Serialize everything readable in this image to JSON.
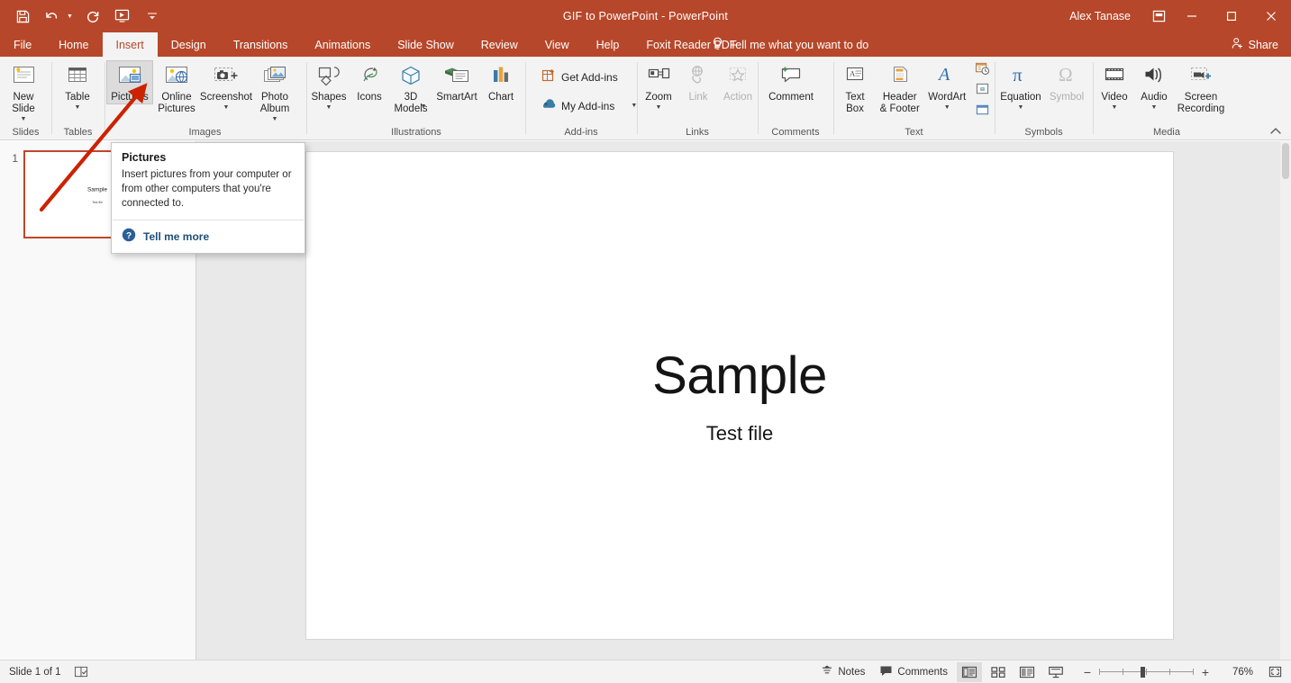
{
  "titlebar": {
    "document_title": "GIF to PowerPoint  -  PowerPoint",
    "account_name": "Alex Tanase",
    "quick_access": [
      {
        "name": "save",
        "label": "Save"
      },
      {
        "name": "undo",
        "label": "Undo"
      },
      {
        "name": "redo",
        "label": "Redo"
      },
      {
        "name": "start-from-beginning",
        "label": "Start From Beginning"
      },
      {
        "name": "customize-qat",
        "label": "Customize Quick Access Toolbar"
      }
    ],
    "window_controls": {
      "ribbon_display_options": "Ribbon Display Options",
      "minimize": "Minimize",
      "restore": "Restore Down",
      "close": "Close"
    }
  },
  "tabs": [
    {
      "label": "File",
      "active": false
    },
    {
      "label": "Home",
      "active": false
    },
    {
      "label": "Insert",
      "active": true
    },
    {
      "label": "Design",
      "active": false
    },
    {
      "label": "Transitions",
      "active": false
    },
    {
      "label": "Animations",
      "active": false
    },
    {
      "label": "Slide Show",
      "active": false
    },
    {
      "label": "Review",
      "active": false
    },
    {
      "label": "View",
      "active": false
    },
    {
      "label": "Help",
      "active": false
    },
    {
      "label": "Foxit Reader PDF",
      "active": false
    }
  ],
  "tell_me": "Tell me what you want to do",
  "share_label": "Share",
  "ribbon": {
    "groups": [
      {
        "name": "Slides",
        "label": "Slides",
        "items": [
          {
            "label": "New\nSlide",
            "icon": "new-slide-icon",
            "dropdown": true,
            "disabled": false
          }
        ]
      },
      {
        "name": "Tables",
        "label": "Tables",
        "items": [
          {
            "label": "Table",
            "icon": "table-icon",
            "dropdown": true,
            "disabled": false
          }
        ]
      },
      {
        "name": "Images",
        "label": "Images",
        "items": [
          {
            "label": "Pictures",
            "icon": "pictures-icon",
            "dropdown": false,
            "disabled": false,
            "pressed": true
          },
          {
            "label": "Online\nPictures",
            "icon": "online-pictures-icon",
            "dropdown": false,
            "disabled": false
          },
          {
            "label": "Screenshot",
            "icon": "screenshot-icon",
            "dropdown": true,
            "disabled": false
          },
          {
            "label": "Photo\nAlbum",
            "icon": "photo-album-icon",
            "dropdown": true,
            "disabled": false
          }
        ]
      },
      {
        "name": "Illustrations",
        "label": "Illustrations",
        "items": [
          {
            "label": "Shapes",
            "icon": "shapes-icon",
            "dropdown": true,
            "disabled": false
          },
          {
            "label": "Icons",
            "icon": "icons-icon",
            "dropdown": false,
            "disabled": false
          },
          {
            "label": "3D\nModels",
            "icon": "3d-models-icon",
            "dropdown": true,
            "disabled": false
          },
          {
            "label": "SmartArt",
            "icon": "smartart-icon",
            "dropdown": false,
            "disabled": false
          },
          {
            "label": "Chart",
            "icon": "chart-icon",
            "dropdown": false,
            "disabled": false
          }
        ]
      },
      {
        "name": "Add-ins",
        "label": "Add-ins",
        "items": [
          {
            "label": "Get Add-ins",
            "icon": "get-addins-icon",
            "dropdown": false,
            "disabled": false
          },
          {
            "label": "My Add-ins",
            "icon": "my-addins-icon",
            "dropdown": true,
            "disabled": false
          }
        ]
      },
      {
        "name": "Links",
        "label": "Links",
        "items": [
          {
            "label": "Zoom",
            "icon": "zoom-icon",
            "dropdown": true,
            "disabled": false
          },
          {
            "label": "Link",
            "icon": "link-icon",
            "dropdown": false,
            "disabled": true
          },
          {
            "label": "Action",
            "icon": "action-icon",
            "dropdown": false,
            "disabled": true
          }
        ]
      },
      {
        "name": "Comments",
        "label": "Comments",
        "items": [
          {
            "label": "Comment",
            "icon": "comment-icon",
            "dropdown": false,
            "disabled": false
          }
        ]
      },
      {
        "name": "Text",
        "label": "Text",
        "items": [
          {
            "label": "Text\nBox",
            "icon": "text-box-icon",
            "dropdown": false,
            "disabled": false
          },
          {
            "label": "Header\n& Footer",
            "icon": "header-footer-icon",
            "dropdown": false,
            "disabled": false
          },
          {
            "label": "WordArt",
            "icon": "wordart-icon",
            "dropdown": true,
            "disabled": false
          },
          {
            "label": "Date & Time",
            "icon": "date-time-icon",
            "mini": true
          },
          {
            "label": "Slide Number",
            "icon": "slide-number-icon",
            "mini": true
          },
          {
            "label": "Object",
            "icon": "object-icon",
            "mini": true
          }
        ]
      },
      {
        "name": "Symbols",
        "label": "Symbols",
        "items": [
          {
            "label": "Equation",
            "icon": "equation-icon",
            "dropdown": true,
            "disabled": false
          },
          {
            "label": "Symbol",
            "icon": "symbol-icon",
            "dropdown": false,
            "disabled": true
          }
        ]
      },
      {
        "name": "Media",
        "label": "Media",
        "items": [
          {
            "label": "Video",
            "icon": "video-icon",
            "dropdown": true,
            "disabled": false
          },
          {
            "label": "Audio",
            "icon": "audio-icon",
            "dropdown": true,
            "disabled": false
          },
          {
            "label": "Screen\nRecording",
            "icon": "screen-recording-icon",
            "dropdown": false,
            "disabled": false
          }
        ]
      }
    ],
    "collapse_label": "Collapse the Ribbon"
  },
  "tooltip": {
    "title": "Pictures",
    "body": "Insert pictures from your computer or from other computers that you're connected to.",
    "more_label": "Tell me more",
    "help_icon": "help-icon"
  },
  "slide_panel": {
    "slides": [
      {
        "number": "1",
        "title": "Sample",
        "subtitle": "Test file",
        "selected": true
      }
    ]
  },
  "slide": {
    "title": "Sample",
    "subtitle": "Test file"
  },
  "statusbar": {
    "slide_count": "Slide 1 of 1",
    "accessibility_label": "Accessibility Checker",
    "notes_label": "Notes",
    "comments_label": "Comments",
    "views": [
      {
        "name": "normal-view",
        "label": "Normal",
        "active": true
      },
      {
        "name": "slide-sorter-view",
        "label": "Slide Sorter",
        "active": false
      },
      {
        "name": "reading-view",
        "label": "Reading View",
        "active": false
      },
      {
        "name": "slide-show-view",
        "label": "Slide Show",
        "active": false
      }
    ],
    "zoom_out_label": "Zoom Out",
    "zoom_in_label": "Zoom In",
    "zoom_level": "76%",
    "fit_label": "Fit slide to current window"
  },
  "annotation": {
    "arrow": "red-arrow-pointing-to-pictures-button",
    "color": "#cc2200"
  },
  "colors": {
    "accent": "#b7472a",
    "ribbon_bg": "#f3f3f3",
    "canvas_bg": "#e9e9e9",
    "link": "#1f4e79"
  }
}
